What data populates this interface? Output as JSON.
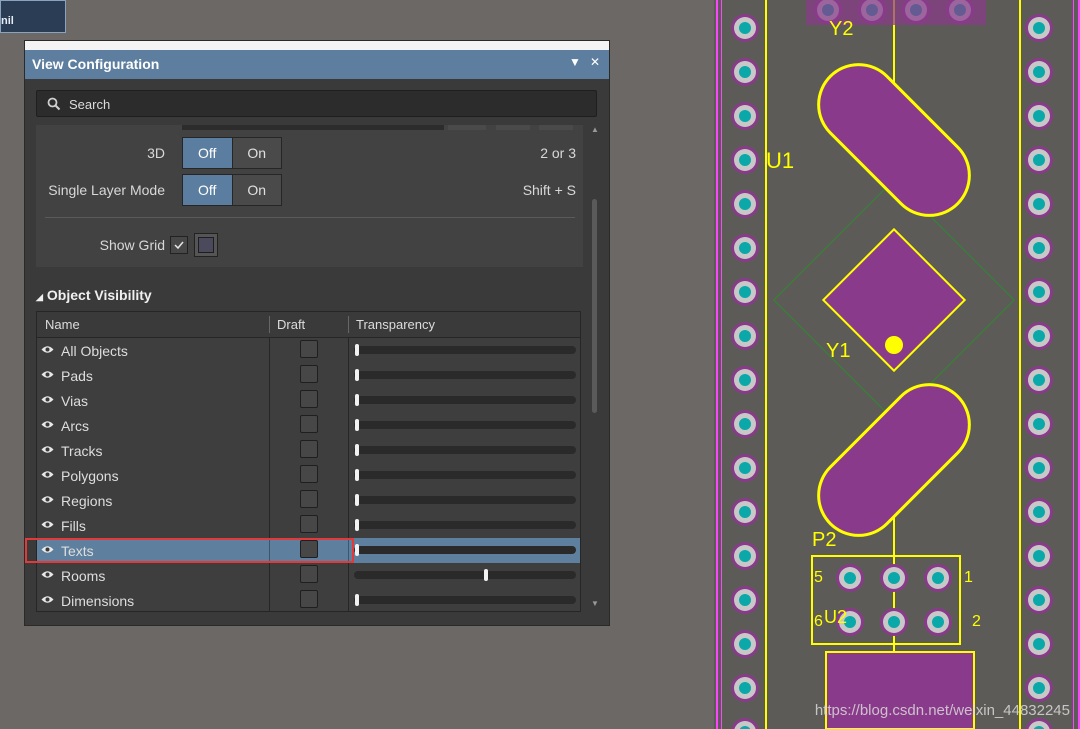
{
  "stub": {
    "label": "nil"
  },
  "panel": {
    "title": "View Configuration",
    "menu_glyph": "▼",
    "close_glyph": "✕",
    "search_placeholder": "Search",
    "config": {
      "rows": [
        {
          "label": "3D",
          "off": "Off",
          "on": "On",
          "hint": "2 or 3",
          "selected": "Off"
        },
        {
          "label": "Single Layer Mode",
          "off": "Off",
          "on": "On",
          "hint": "Shift + S",
          "selected": "Off"
        }
      ],
      "show_grid": {
        "label": "Show Grid",
        "checked": true
      }
    },
    "section_title": "Object Visibility",
    "columns": {
      "name": "Name",
      "draft": "Draft",
      "transparency": "Transparency"
    },
    "objects": [
      {
        "name": "All Objects",
        "draft": false,
        "transparency": 0.0
      },
      {
        "name": "Pads",
        "draft": false,
        "transparency": 0.0
      },
      {
        "name": "Vias",
        "draft": false,
        "transparency": 0.0
      },
      {
        "name": "Arcs",
        "draft": false,
        "transparency": 0.0
      },
      {
        "name": "Tracks",
        "draft": false,
        "transparency": 0.0
      },
      {
        "name": "Polygons",
        "draft": false,
        "transparency": 0.0
      },
      {
        "name": "Regions",
        "draft": false,
        "transparency": 0.0
      },
      {
        "name": "Fills",
        "draft": false,
        "transparency": 0.0
      },
      {
        "name": "Texts",
        "draft": false,
        "transparency": 0.0,
        "selected": true
      },
      {
        "name": "Rooms",
        "draft": false,
        "transparency": 0.6
      },
      {
        "name": "Dimensions",
        "draft": false,
        "transparency": 0.0
      }
    ]
  },
  "pcb": {
    "designators": [
      "Y2",
      "U1",
      "Y1",
      "P2",
      "U2"
    ],
    "connector_pins": [
      "5",
      "1",
      "6",
      "2"
    ],
    "colors": {
      "silkscreen": "#ffff00",
      "pad": "#0aa8a8",
      "pad_ring": "#c8c8c8",
      "pad_outer": "#8a3a8a",
      "smd_green": "#22dd22",
      "smd_blue": "#1a1aff"
    }
  },
  "watermark": "https://blog.csdn.net/weixin_44832245"
}
